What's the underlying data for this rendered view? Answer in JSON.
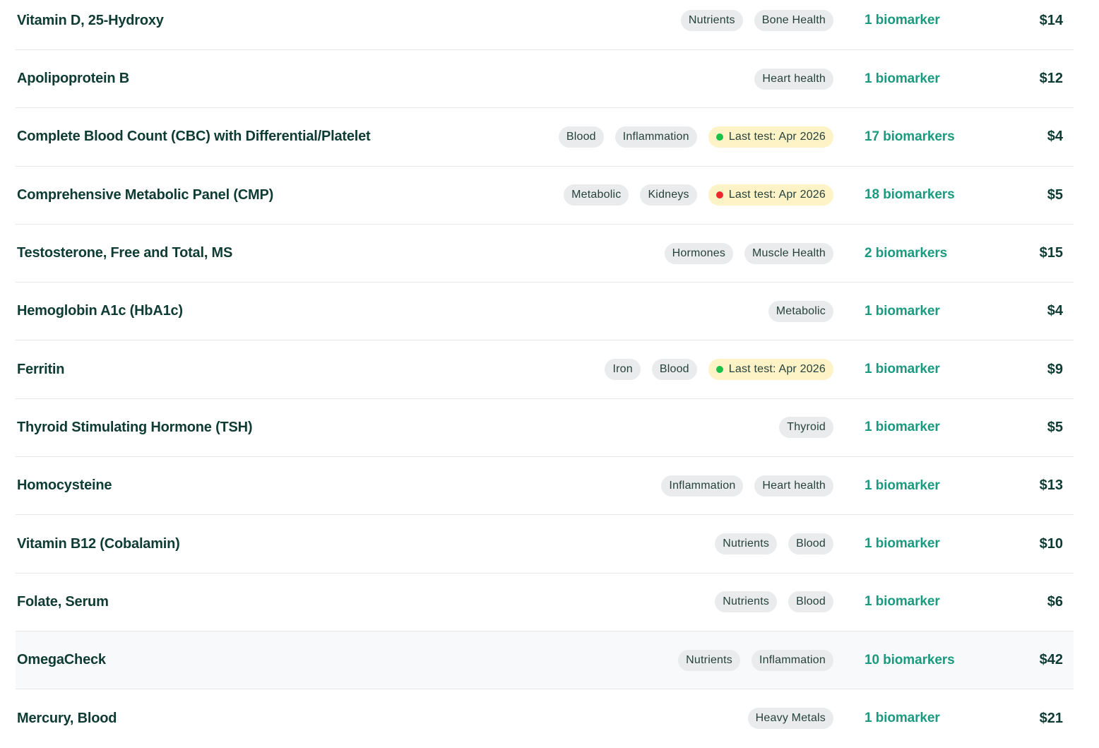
{
  "colors": {
    "dot_green": "#18c24a",
    "dot_red": "#f0262f",
    "accent": "#1a9a7f",
    "text": "#0e3b33"
  },
  "tests": [
    {
      "name": "Vitamin D, 25-Hydroxy",
      "tags": [
        "Nutrients",
        "Bone Health"
      ],
      "last_test": null,
      "biomarkers": "1 biomarker",
      "price": "$14"
    },
    {
      "name": "Apolipoprotein B",
      "tags": [
        "Heart health"
      ],
      "last_test": null,
      "biomarkers": "1 biomarker",
      "price": "$12"
    },
    {
      "name": "Complete Blood Count (CBC) with Differential/Platelet",
      "tags": [
        "Blood",
        "Inflammation"
      ],
      "last_test": {
        "label": "Last test: Apr 2026",
        "status": "green"
      },
      "biomarkers": "17 biomarkers",
      "price": "$4"
    },
    {
      "name": "Comprehensive Metabolic Panel (CMP)",
      "tags": [
        "Metabolic",
        "Kidneys"
      ],
      "last_test": {
        "label": "Last test: Apr 2026",
        "status": "red"
      },
      "biomarkers": "18 biomarkers",
      "price": "$5"
    },
    {
      "name": "Testosterone, Free and Total, MS",
      "tags": [
        "Hormones",
        "Muscle Health"
      ],
      "last_test": null,
      "biomarkers": "2 biomarkers",
      "price": "$15"
    },
    {
      "name": "Hemoglobin A1c (HbA1c)",
      "tags": [
        "Metabolic"
      ],
      "last_test": null,
      "biomarkers": "1 biomarker",
      "price": "$4"
    },
    {
      "name": "Ferritin",
      "tags": [
        "Iron",
        "Blood"
      ],
      "last_test": {
        "label": "Last test: Apr 2026",
        "status": "green"
      },
      "biomarkers": "1 biomarker",
      "price": "$9"
    },
    {
      "name": "Thyroid Stimulating Hormone (TSH)",
      "tags": [
        "Thyroid"
      ],
      "last_test": null,
      "biomarkers": "1 biomarker",
      "price": "$5"
    },
    {
      "name": "Homocysteine",
      "tags": [
        "Inflammation",
        "Heart health"
      ],
      "last_test": null,
      "biomarkers": "1 biomarker",
      "price": "$13"
    },
    {
      "name": "Vitamin B12 (Cobalamin)",
      "tags": [
        "Nutrients",
        "Blood"
      ],
      "last_test": null,
      "biomarkers": "1 biomarker",
      "price": "$10"
    },
    {
      "name": "Folate, Serum",
      "tags": [
        "Nutrients",
        "Blood"
      ],
      "last_test": null,
      "biomarkers": "1 biomarker",
      "price": "$6"
    },
    {
      "name": "OmegaCheck",
      "tags": [
        "Nutrients",
        "Inflammation"
      ],
      "last_test": null,
      "biomarkers": "10 biomarkers",
      "price": "$42",
      "hovered": true
    },
    {
      "name": "Mercury, Blood",
      "tags": [
        "Heavy Metals"
      ],
      "last_test": null,
      "biomarkers": "1 biomarker",
      "price": "$21"
    }
  ]
}
